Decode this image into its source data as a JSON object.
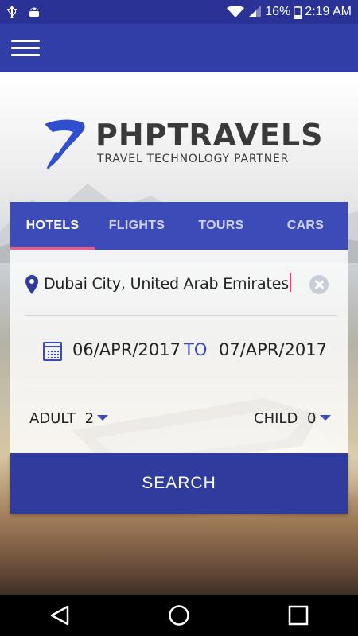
{
  "status_bar": {
    "battery": "16%",
    "time": "2:19 AM",
    "icons": [
      "usb-icon",
      "android-debug-icon",
      "wifi-icon",
      "signal-icon",
      "battery-icon"
    ]
  },
  "toolbar": {
    "menu_icon": "hamburger-menu-icon"
  },
  "logo": {
    "name": "PHPTRAVELS",
    "tagline": "TRAVEL TECHNOLOGY PARTNER"
  },
  "tabs": [
    {
      "label": "HOTELS",
      "active": true
    },
    {
      "label": "FLIGHTS",
      "active": false
    },
    {
      "label": "TOURS",
      "active": false
    },
    {
      "label": "CARS",
      "active": false
    }
  ],
  "search": {
    "location_value": "Dubai City, United Arab Emirates",
    "checkin": "06/APR/2017",
    "separator": "TO",
    "checkout": "07/APR/2017",
    "adult_label": "ADULT",
    "adult_value": "2",
    "child_label": "CHILD",
    "child_value": "0",
    "button_label": "SEARCH"
  },
  "colors": {
    "primary": "#323ea8",
    "primary_dark": "#2a3296",
    "accent": "#ef5a8a"
  }
}
